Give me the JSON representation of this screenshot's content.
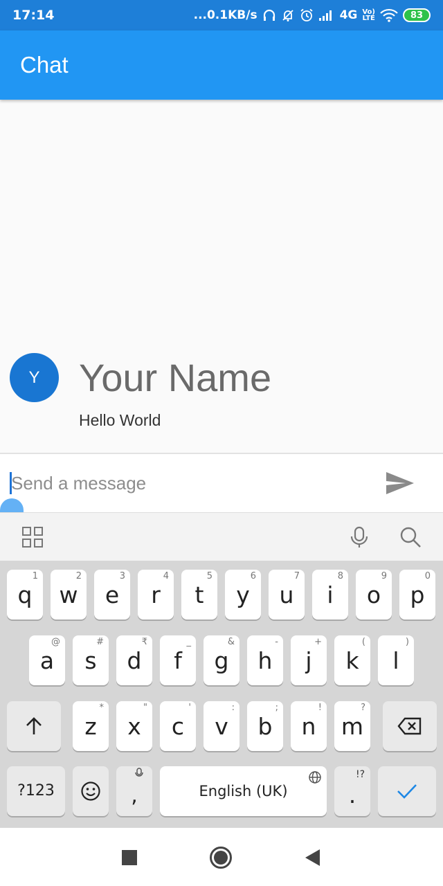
{
  "status_bar": {
    "time": "17:14",
    "network_speed": "...0.1KB/s",
    "signal_label": "4G",
    "volte_top": "Vo)",
    "volte_bottom": "LTE",
    "battery": "83"
  },
  "app_bar": {
    "title": "Chat"
  },
  "messages": [
    {
      "avatar_letter": "Y",
      "name": "Your Name",
      "text": "Hello World"
    }
  ],
  "composer": {
    "placeholder": "Send a message",
    "value": ""
  },
  "keyboard": {
    "row1": [
      {
        "key": "q",
        "hint": "1"
      },
      {
        "key": "w",
        "hint": "2"
      },
      {
        "key": "e",
        "hint": "3"
      },
      {
        "key": "r",
        "hint": "4"
      },
      {
        "key": "t",
        "hint": "5"
      },
      {
        "key": "y",
        "hint": "6"
      },
      {
        "key": "u",
        "hint": "7"
      },
      {
        "key": "i",
        "hint": "8"
      },
      {
        "key": "o",
        "hint": "9"
      },
      {
        "key": "p",
        "hint": "0"
      }
    ],
    "row2": [
      {
        "key": "a",
        "hint": "@"
      },
      {
        "key": "s",
        "hint": "#"
      },
      {
        "key": "d",
        "hint": "₹"
      },
      {
        "key": "f",
        "hint": "_"
      },
      {
        "key": "g",
        "hint": "&"
      },
      {
        "key": "h",
        "hint": "-"
      },
      {
        "key": "j",
        "hint": "+"
      },
      {
        "key": "k",
        "hint": "("
      },
      {
        "key": "l",
        "hint": ")"
      }
    ],
    "row3": [
      {
        "key": "z",
        "hint": "*"
      },
      {
        "key": "x",
        "hint": "\""
      },
      {
        "key": "c",
        "hint": "'"
      },
      {
        "key": "v",
        "hint": ":"
      },
      {
        "key": "b",
        "hint": ";"
      },
      {
        "key": "n",
        "hint": "!"
      },
      {
        "key": "m",
        "hint": "?"
      }
    ],
    "symbols_label": "?123",
    "comma_label": ",",
    "space_label": "English (UK)",
    "period_label": ".",
    "period_hint": "!?"
  },
  "icons": {
    "statusbar": [
      "headphones-icon",
      "bell-off-icon",
      "alarm-icon",
      "signal-icon",
      "wifi-icon",
      "battery-icon"
    ],
    "composer": [
      "send-icon"
    ],
    "toolbar": [
      "apps-grid-icon",
      "microphone-icon",
      "search-icon"
    ],
    "keyboard": [
      "shift-icon",
      "backspace-icon",
      "emoji-icon",
      "globe-icon",
      "checkmark-icon"
    ],
    "navbar": [
      "recents-icon",
      "home-icon",
      "back-icon"
    ]
  },
  "colors": {
    "status_bar": "#1e7fd8",
    "app_bar": "#2196f3",
    "avatar": "#1976d2",
    "battery": "#2ec24a",
    "checkmark": "#1e88e5"
  }
}
